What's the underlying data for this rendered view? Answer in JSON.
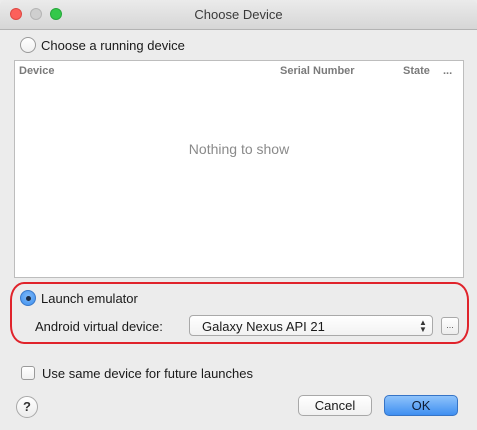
{
  "window": {
    "title": "Choose Device"
  },
  "running": {
    "label": "Choose a running device",
    "selected": false,
    "columns": [
      "Device",
      "Serial Number",
      "State",
      "..."
    ],
    "empty_text": "Nothing to show"
  },
  "emulator": {
    "label": "Launch emulator",
    "selected": true,
    "avd_label": "Android virtual device:",
    "avd_value": "Galaxy Nexus API 21",
    "browse_label": "..."
  },
  "reuse": {
    "label": "Use same device for future launches",
    "checked": false
  },
  "footer": {
    "help_label": "?",
    "cancel_label": "Cancel",
    "ok_label": "OK"
  },
  "annotation": {
    "color": "#e0232b"
  }
}
